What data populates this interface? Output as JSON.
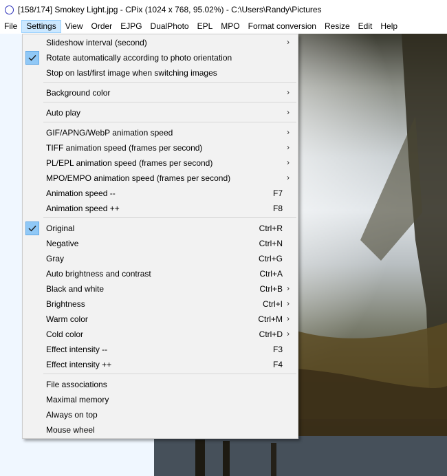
{
  "window": {
    "title": "[158/174] Smokey Light.jpg - CPix (1024 x 768, 95.02%) - C:\\Users\\Randy\\Pictures"
  },
  "menubar": [
    {
      "label": "File"
    },
    {
      "label": "Settings",
      "active": true
    },
    {
      "label": "View"
    },
    {
      "label": "Order"
    },
    {
      "label": "EJPG"
    },
    {
      "label": "DualPhoto"
    },
    {
      "label": "EPL"
    },
    {
      "label": "MPO"
    },
    {
      "label": "Format conversion"
    },
    {
      "label": "Resize"
    },
    {
      "label": "Edit"
    },
    {
      "label": "Help"
    }
  ],
  "settings_menu": {
    "items": [
      {
        "label": "Slideshow interval (second)",
        "submenu": true
      },
      {
        "label": "Rotate automatically according to photo orientation",
        "checked": true
      },
      {
        "label": "Stop on last/first image when switching images"
      },
      {
        "label": "Background color",
        "submenu": true
      },
      {
        "label": "Auto play",
        "submenu": true
      },
      {
        "label": "GIF/APNG/WebP animation speed",
        "submenu": true
      },
      {
        "label": "TIFF animation speed (frames per second)",
        "submenu": true
      },
      {
        "label": "PL/EPL animation speed (frames per second)",
        "submenu": true
      },
      {
        "label": "MPO/EMPO animation speed (frames per second)",
        "submenu": true
      },
      {
        "label": "Animation speed --",
        "shortcut": "F7"
      },
      {
        "label": "Animation speed ++",
        "shortcut": "F8"
      },
      {
        "label": "Original",
        "shortcut": "Ctrl+R",
        "checked": true
      },
      {
        "label": "Negative",
        "shortcut": "Ctrl+N"
      },
      {
        "label": "Gray",
        "shortcut": "Ctrl+G"
      },
      {
        "label": "Auto brightness and contrast",
        "shortcut": "Ctrl+A"
      },
      {
        "label": "Black and white",
        "shortcut": "Ctrl+B",
        "submenu": true
      },
      {
        "label": "Brightness",
        "shortcut": "Ctrl+I",
        "submenu": true
      },
      {
        "label": "Warm color",
        "shortcut": "Ctrl+M",
        "submenu": true
      },
      {
        "label": "Cold color",
        "shortcut": "Ctrl+D",
        "submenu": true
      },
      {
        "label": "Effect intensity --",
        "shortcut": "F3"
      },
      {
        "label": "Effect intensity ++",
        "shortcut": "F4"
      },
      {
        "label": "File associations"
      },
      {
        "label": "Maximal memory"
      },
      {
        "label": "Always on top"
      },
      {
        "label": "Mouse wheel"
      }
    ]
  },
  "colors": {
    "menu_bg": "#f2f2f2",
    "active_menu_bg": "#cce8ff",
    "check_bg": "#90c8f6",
    "app_icon": "#2a2fb8"
  }
}
